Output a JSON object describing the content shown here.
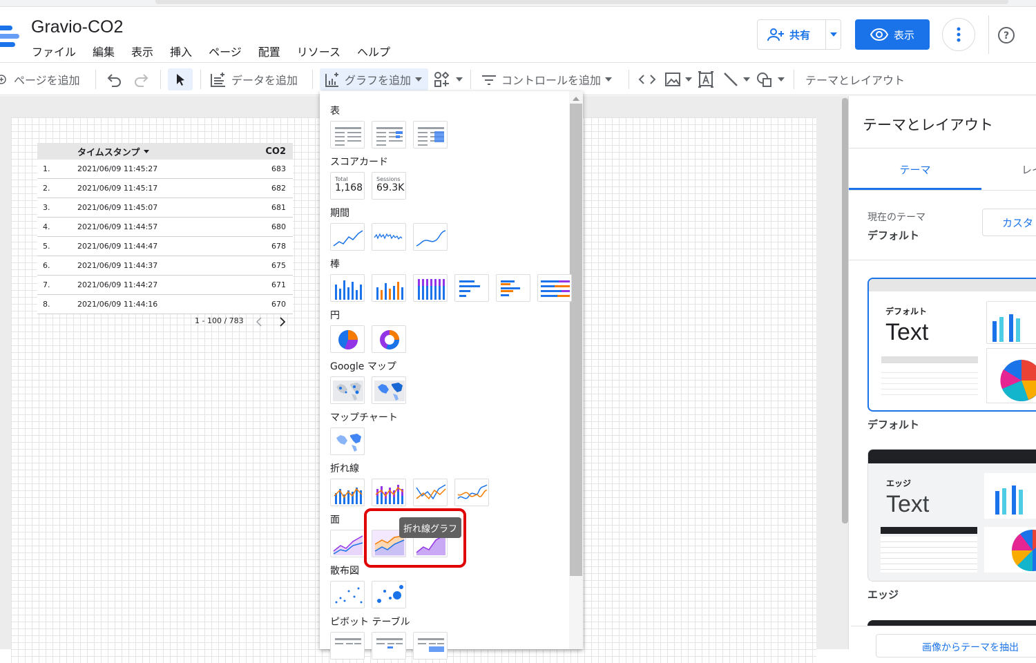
{
  "app": {
    "title": "Gravio-CO2",
    "menu": [
      "ファイル",
      "編集",
      "表示",
      "挿入",
      "ページ",
      "配置",
      "リソース",
      "ヘルプ"
    ],
    "share_label": "共有",
    "view_label": "表示"
  },
  "toolbar": {
    "add_page": "ページを追加",
    "add_data": "データを追加",
    "add_chart": "グラフを追加",
    "add_control": "コントロールを追加",
    "theme_layout": "テーマとレイアウト"
  },
  "table": {
    "headers": [
      "タイムスタンプ",
      "CO2"
    ],
    "rows": [
      [
        "1.",
        "2021/06/09 11:45:27",
        "683"
      ],
      [
        "2.",
        "2021/06/09 11:45:17",
        "682"
      ],
      [
        "3.",
        "2021/06/09 11:45:07",
        "681"
      ],
      [
        "4.",
        "2021/06/09 11:44:57",
        "680"
      ],
      [
        "5.",
        "2021/06/09 11:44:47",
        "678"
      ],
      [
        "6.",
        "2021/06/09 11:44:37",
        "675"
      ],
      [
        "7.",
        "2021/06/09 11:44:27",
        "671"
      ],
      [
        "8.",
        "2021/06/09 11:44:16",
        "670"
      ]
    ],
    "pagination": "1 - 100 / 783"
  },
  "chart_menu": {
    "sections": [
      "表",
      "スコアカード",
      "期間",
      "棒",
      "円",
      "Google マップ",
      "マップチャート",
      "折れ線",
      "面",
      "散布図",
      "ピボット テーブル"
    ],
    "scorecards": [
      {
        "label": "Total",
        "value": "1,168"
      },
      {
        "label": "Sessions",
        "value": "69.3K"
      }
    ],
    "tooltip": "折れ線グラフ"
  },
  "panel": {
    "title": "テーマとレイアウト",
    "tabs": [
      "テーマ",
      "レイ"
    ],
    "current_theme_label": "現在のテーマ",
    "current_theme": "デフォルト",
    "customize_label": "カスタ",
    "themes": [
      {
        "name": "デフォルト",
        "sample_title": "デフォルト",
        "sample_text": "Text"
      },
      {
        "name": "エッジ",
        "sample_title": "エッジ",
        "sample_text": "Text"
      }
    ],
    "extract_label": "画像からテーマを抽出"
  },
  "colors": {
    "accent": "#1a73e8",
    "highlight": "#e00000",
    "orange": "#f57c00",
    "purple": "#9334e6"
  }
}
